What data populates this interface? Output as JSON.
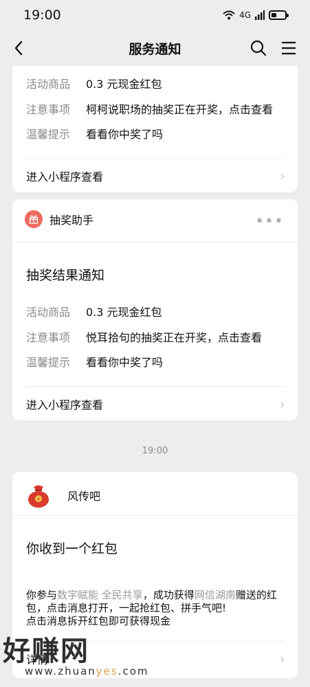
{
  "status_bar": {
    "time": "19:00",
    "network": "4G"
  },
  "nav": {
    "title": "服务通知"
  },
  "card_top": {
    "rows": [
      {
        "key": "活动商品",
        "value": "0.3 元现金红包"
      },
      {
        "key": "注意事项",
        "value": "柯柯说职场的抽奖正在开奖，点击查看"
      },
      {
        "key": "温馨提示",
        "value": "看看你中奖了吗"
      }
    ],
    "link": "进入小程序查看"
  },
  "card_lottery": {
    "sender": "抽奖助手",
    "title": "抽奖结果通知",
    "rows": [
      {
        "key": "活动商品",
        "value": "0.3 元现金红包"
      },
      {
        "key": "注意事项",
        "value": "悦耳拾句的抽奖正在开奖，点击查看"
      },
      {
        "key": "温馨提示",
        "value": "看看你中奖了吗"
      }
    ],
    "link": "进入小程序查看"
  },
  "time_separator": "19:00",
  "card_redpacket": {
    "sender": "风传吧",
    "title": "你收到一个红包",
    "body": {
      "p1": "你参与",
      "p2": "数字赋能 全民共享",
      "p3": "，成功获得",
      "p4": "网信湖南",
      "p5": "赠送的红包，点击消息打开，一起抢红包、拼手气吧!",
      "p6": "点击消息拆开红包即可获得现金"
    },
    "link": "详情"
  },
  "watermark": {
    "text": "好赚网",
    "url_a": "www.zhuan",
    "url_b": "yes",
    "url_c": ".com"
  }
}
